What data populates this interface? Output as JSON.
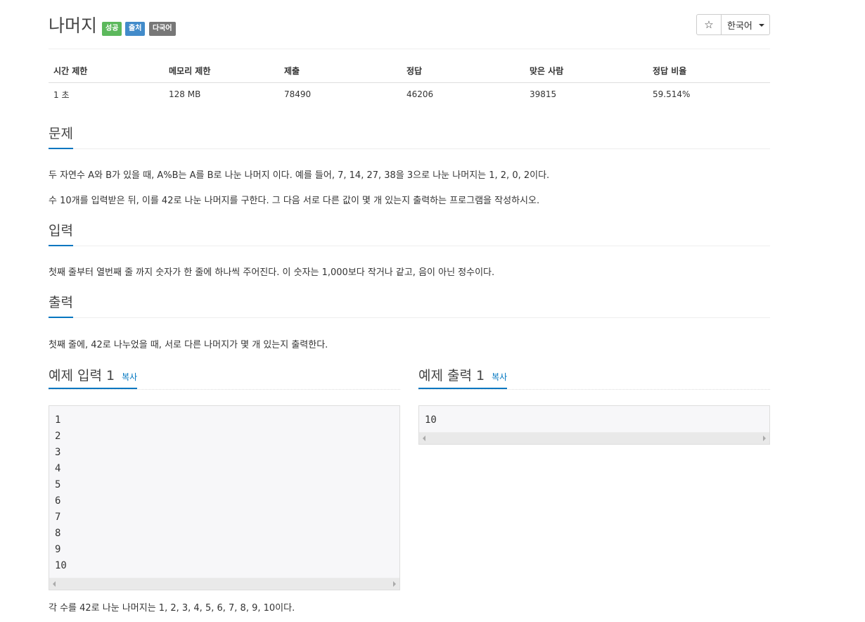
{
  "header": {
    "title": "나머지",
    "badges": [
      "성공",
      "출처",
      "다국어"
    ],
    "star_icon": "☆",
    "language": "한국어"
  },
  "info_table": {
    "headers": [
      "시간 제한",
      "메모리 제한",
      "제출",
      "정답",
      "맞은 사람",
      "정답 비율"
    ],
    "values": [
      "1 초",
      "128 MB",
      "78490",
      "46206",
      "39815",
      "59.514%"
    ]
  },
  "problem": {
    "title": "문제",
    "paragraphs": [
      "두 자연수 A와 B가 있을 때, A%B는 A를 B로 나눈 나머지 이다. 예를 들어, 7, 14, 27, 38을 3으로 나눈 나머지는 1, 2, 0, 2이다.",
      "수 10개를 입력받은 뒤, 이를 42로 나눈 나머지를 구한다. 그 다음 서로 다른 값이 몇 개 있는지 출력하는 프로그램을 작성하시오."
    ]
  },
  "input": {
    "title": "입력",
    "text": "첫째 줄부터 열번째 줄 까지 숫자가 한 줄에 하나씩 주어진다. 이 숫자는 1,000보다 작거나 같고, 음이 아닌 정수이다."
  },
  "output": {
    "title": "출력",
    "text": "첫째 줄에, 42로 나누었을 때, 서로 다른 나머지가 몇 개 있는지 출력한다."
  },
  "sample_input": {
    "title": "예제 입력 1",
    "copy_label": "복사",
    "lines": [
      "1",
      "2",
      "3",
      "4",
      "5",
      "6",
      "7",
      "8",
      "9",
      "10"
    ]
  },
  "sample_output": {
    "title": "예제 출력 1",
    "copy_label": "복사",
    "lines": [
      "10"
    ]
  },
  "hint": "각 수를 42로 나눈 나머지는 1, 2, 3, 4, 5, 6, 7, 8, 9, 10이다.",
  "colors": {
    "success_badge": "#5cb85c",
    "source_badge": "#428bca",
    "multilang_badge": "#777777",
    "accent": "#0076c0"
  }
}
